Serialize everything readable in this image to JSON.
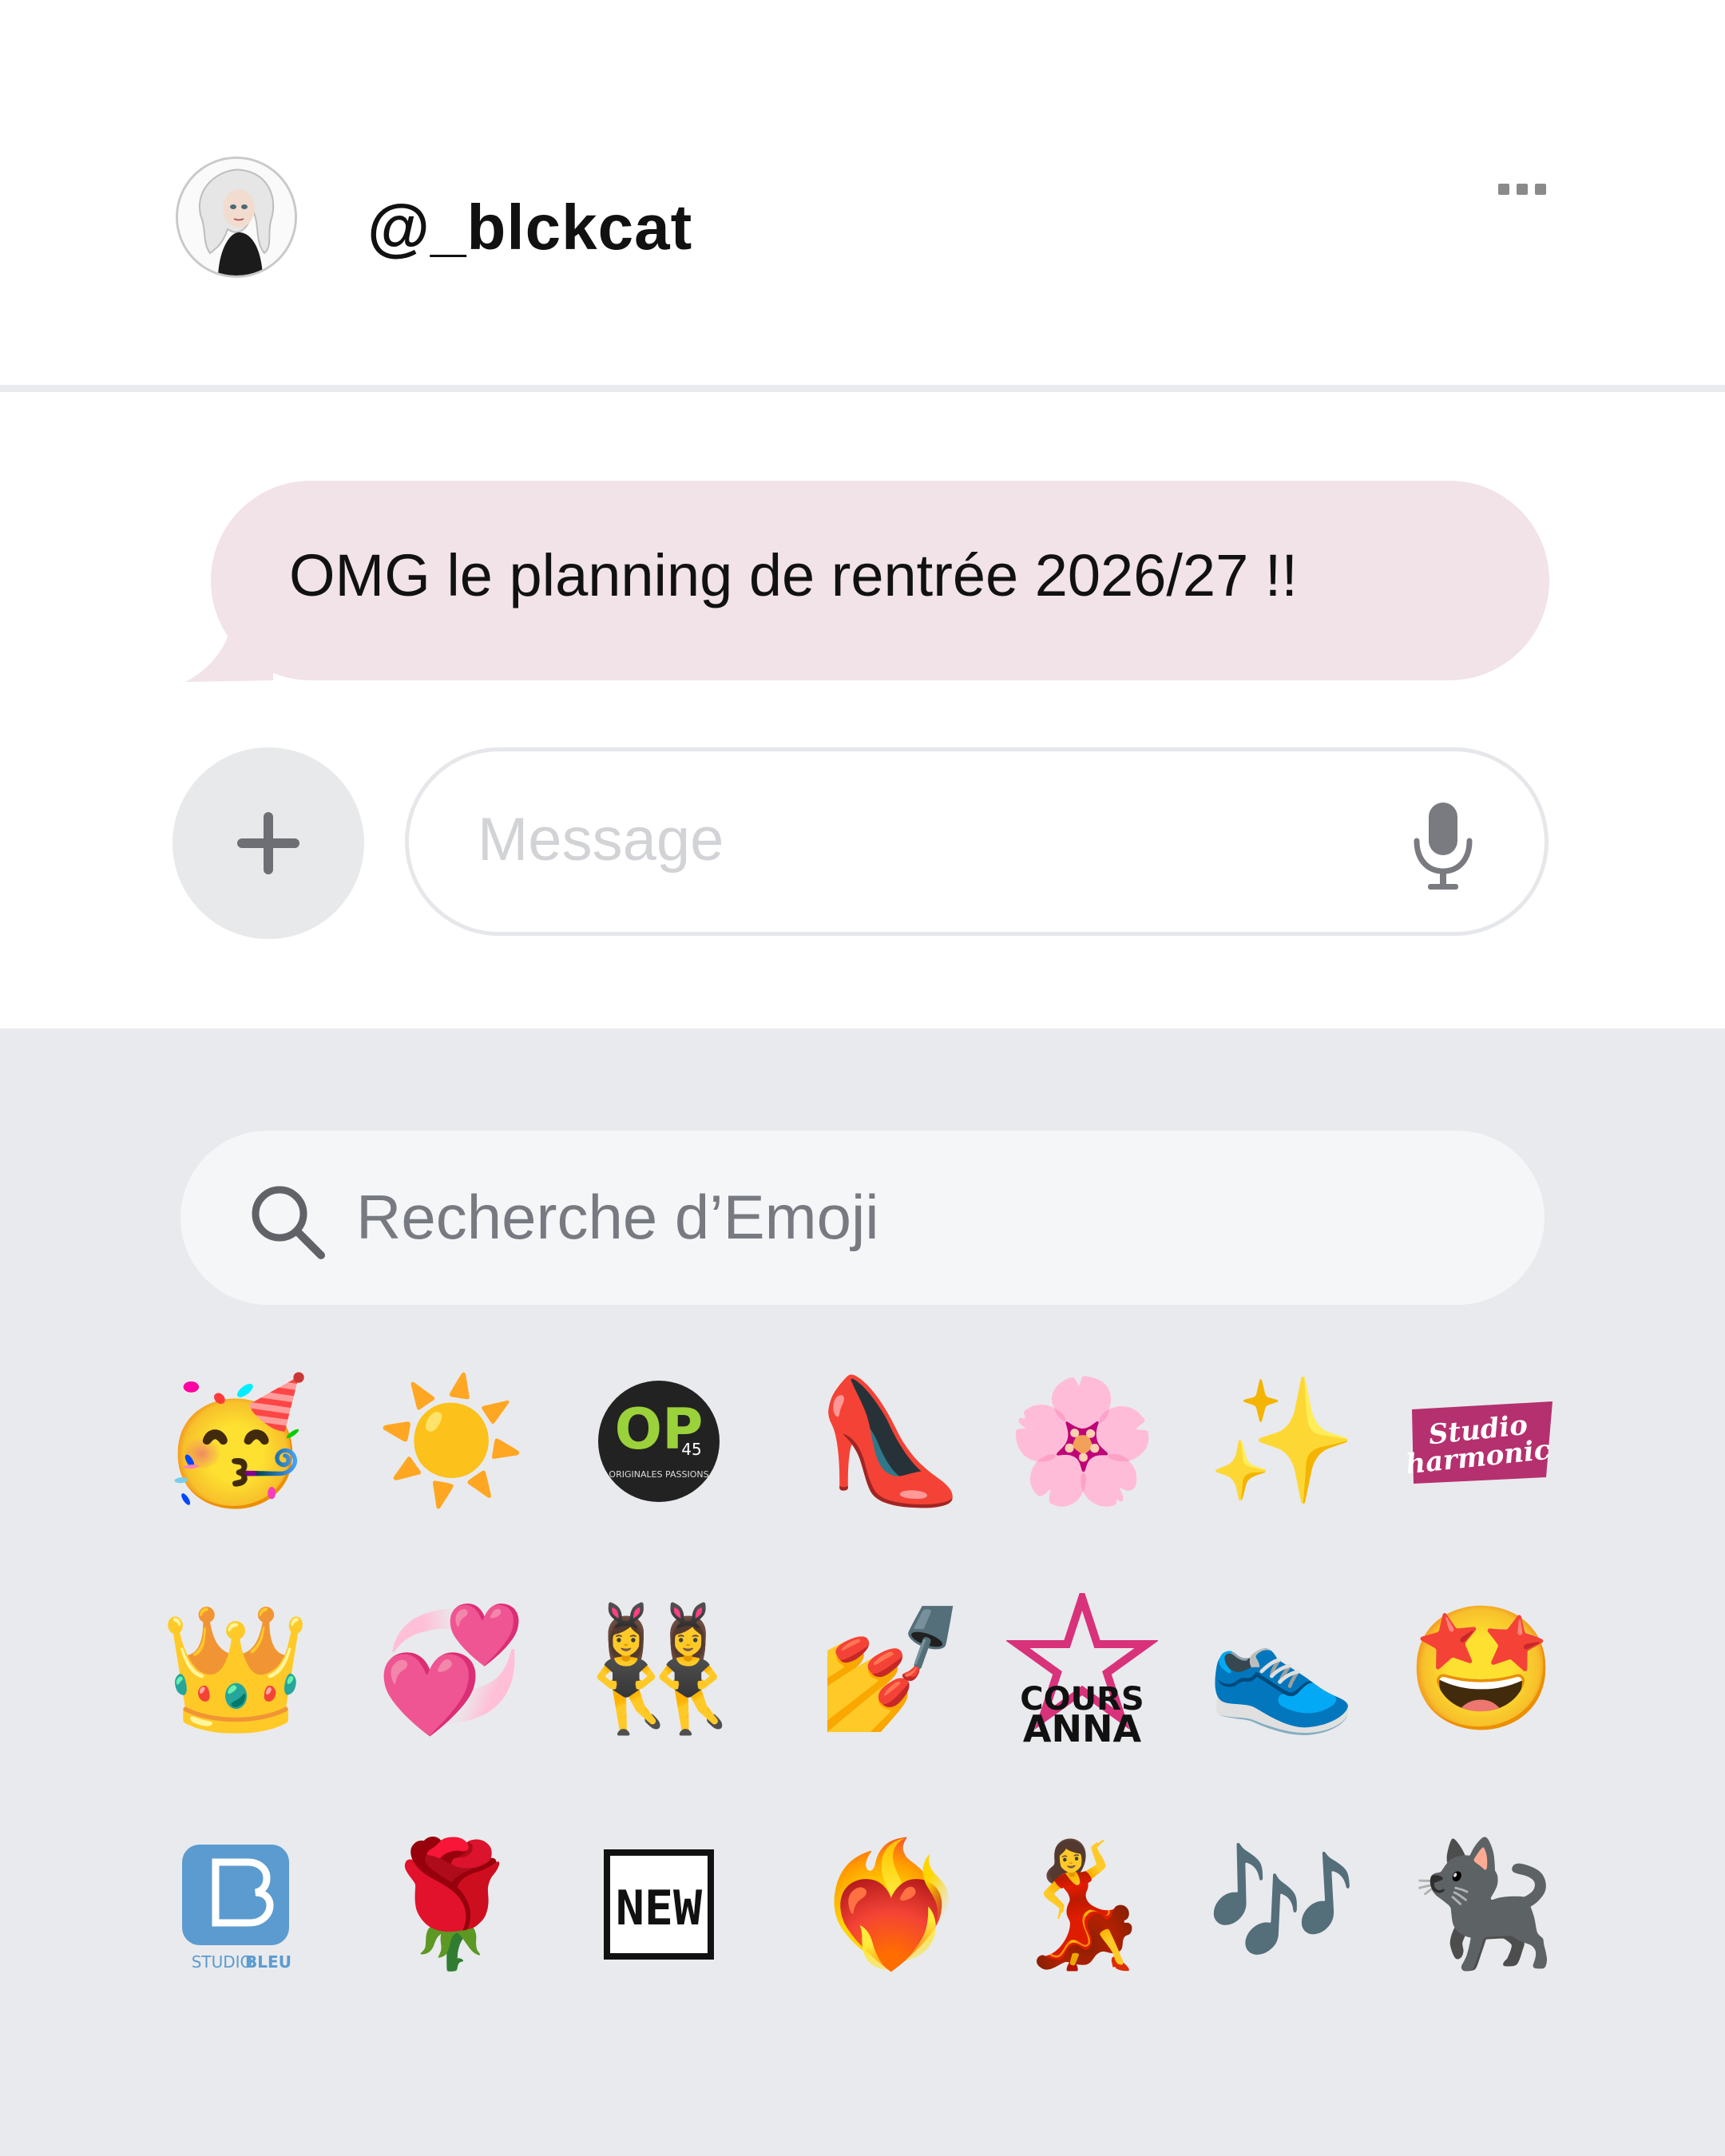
{
  "header": {
    "username": "@_blckcat"
  },
  "conversation": {
    "message": "OMG le planning de rentrée 2026/27 !!"
  },
  "composer": {
    "placeholder": "Message"
  },
  "emoji_search": {
    "placeholder": "Recherche d’Emoji"
  },
  "emoji_rows": [
    [
      {
        "name": "partying-face-emoji",
        "glyph": "🥳"
      },
      {
        "name": "sun-emoji",
        "glyph": "☀️"
      },
      {
        "name": "op45-originales-passions-logo",
        "text": "OP",
        "sub": "45",
        "caption": "ORIGINALES PASSIONS"
      },
      {
        "name": "high-heel-emoji",
        "glyph": "👠"
      },
      {
        "name": "cherry-blossom-emoji",
        "glyph": "🌸"
      },
      {
        "name": "sparkles-emoji",
        "glyph": "✨"
      },
      {
        "name": "studio-harmonic-logo",
        "text": "Studio",
        "sub": "harmonic"
      }
    ],
    [
      {
        "name": "crown-emoji",
        "glyph": "👑"
      },
      {
        "name": "revolving-hearts-emoji",
        "glyph": "💞"
      },
      {
        "name": "dancers-emoji",
        "glyph": "👯‍♀️"
      },
      {
        "name": "nail-polish-emoji",
        "glyph": "💅"
      },
      {
        "name": "cours-anna-logo",
        "text": "COURS",
        "sub": "ANNA"
      },
      {
        "name": "running-shoe-emoji",
        "glyph": "👟"
      },
      {
        "name": "star-struck-emoji",
        "glyph": "🤩"
      }
    ],
    [
      {
        "name": "studio-bleu-logo",
        "text": "STUDIO",
        "sub": "BLEU"
      },
      {
        "name": "rose-emoji",
        "glyph": "🌹"
      },
      {
        "name": "new-logo",
        "text": "NEW"
      },
      {
        "name": "heart-on-fire-emoji",
        "glyph": "❤️‍🔥"
      },
      {
        "name": "woman-dancing-emoji",
        "glyph": "💃"
      },
      {
        "name": "musical-notes-emoji",
        "glyph": "🎶"
      },
      {
        "name": "black-cat-emoji",
        "glyph": "🐈‍⬛"
      }
    ]
  ],
  "colors": {
    "bubble": "#f1e3e8",
    "keyboard_bg": "#e9eaed",
    "search_bg": "#f5f6f8"
  }
}
